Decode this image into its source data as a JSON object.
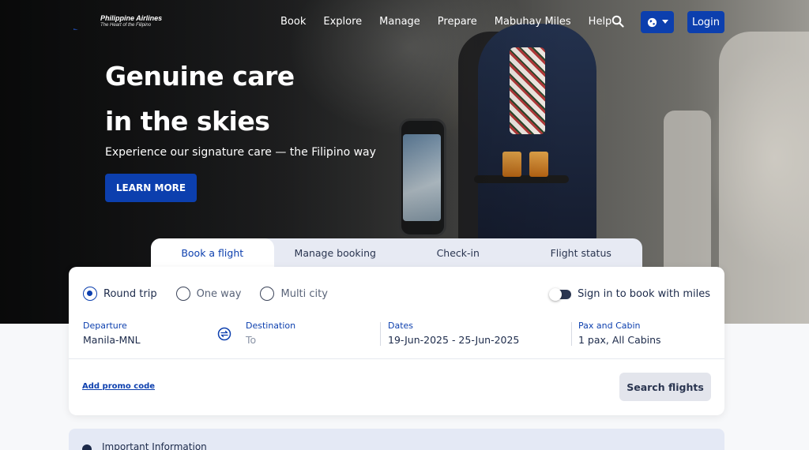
{
  "brand": {
    "name": "Philippine Airlines",
    "tagline": "The Heart of the Filipino"
  },
  "nav": {
    "links": [
      "Book",
      "Explore",
      "Manage",
      "Prepare",
      "Mabuhay Miles",
      "Help"
    ],
    "search_icon": "search-icon",
    "globe_icon": "globe-icon",
    "login_label": "Login"
  },
  "hero": {
    "title_line1": "Genuine care",
    "title_line2": "in the skies",
    "subtitle": "Experience our signature care — the Filipino way",
    "cta_label": "LEARN MORE"
  },
  "booking": {
    "tabs": [
      {
        "label": "Book a flight",
        "active": true
      },
      {
        "label": "Manage booking",
        "active": false
      },
      {
        "label": "Check-in",
        "active": false
      },
      {
        "label": "Flight status",
        "active": false
      }
    ],
    "trip_types": [
      {
        "label": "Round trip",
        "selected": true
      },
      {
        "label": "One way",
        "selected": false
      },
      {
        "label": "Multi city",
        "selected": false
      }
    ],
    "miles_toggle_label": "Sign in to book with miles",
    "departure": {
      "label": "Departure",
      "value": "Manila-MNL"
    },
    "destination": {
      "label": "Destination",
      "placeholder": "To"
    },
    "dates": {
      "label": "Dates",
      "value": "19-Jun-2025 - 25-Jun-2025"
    },
    "pax": {
      "label": "Pax and Cabin",
      "value": "1 pax, All Cabins"
    },
    "promo_label": "Add promo code",
    "search_label": "Search flights"
  },
  "info": {
    "title": "Important Information"
  },
  "colors": {
    "primary": "#0c3fae",
    "label": "#0c3fae",
    "text": "#1c2a4a",
    "tab_bg": "#e7eaf3",
    "search_btn_bg": "#e3e5ec",
    "info_bg": "#e4e9f5"
  }
}
